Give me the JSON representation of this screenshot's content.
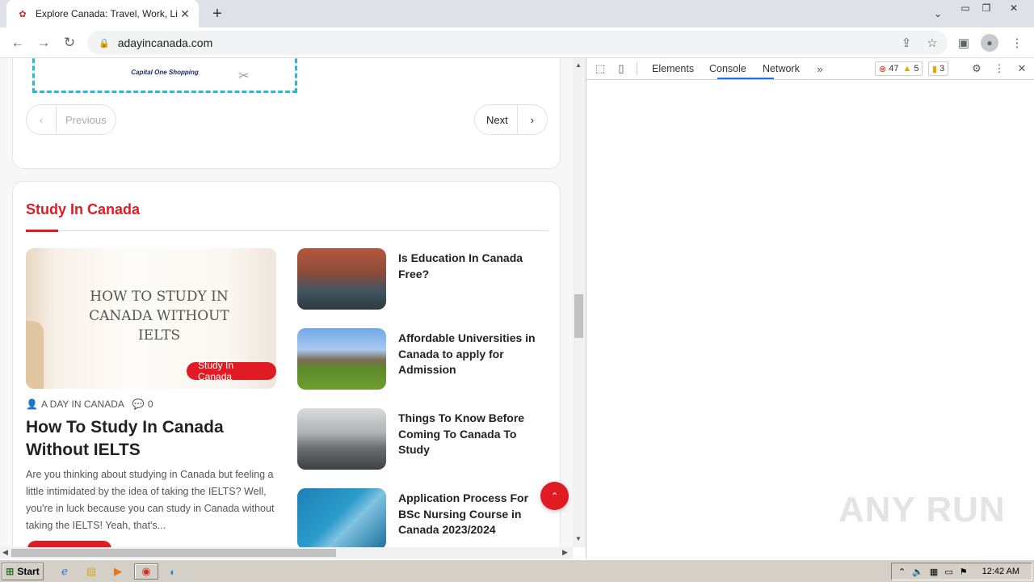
{
  "browser": {
    "tab_title": "Explore Canada: Travel, Work, Live, ...",
    "url": "adayincanada.com",
    "new_tab": "+",
    "window_controls": [
      "minimize",
      "restore",
      "close"
    ]
  },
  "page": {
    "coupon": {
      "logo_text": "Capital One Shopping"
    },
    "pagination": {
      "previous": "Previous",
      "next": "Next"
    },
    "section": {
      "title": "Study In Canada",
      "featured": {
        "image_caption": "HOW TO STUDY IN CANADA WITHOUT IELTS",
        "badge": "Study In Canada",
        "author": "A DAY IN CANADA",
        "comments": "0",
        "title": "How To Study In Canada Without IELTS",
        "excerpt": "Are you thinking about studying in Canada but feeling a little intimidated by the idea of taking the IELTS? Well, you're in luck because you can study in Canada without taking the IELTS! Yeah, that's..."
      },
      "list": [
        {
          "title": "Is Education In Canada Free?"
        },
        {
          "title": "Affordable Universities in Canada to apply for Admission"
        },
        {
          "title": "Things To Know Before Coming To Canada To Study"
        },
        {
          "title": "Application Process For BSc Nursing Course in Canada 2023/2024"
        }
      ]
    }
  },
  "devtools": {
    "tabs": [
      "Elements",
      "Console",
      "Network"
    ],
    "active_tab": "Network",
    "errors": "47",
    "warnings": "5",
    "issues": "3",
    "watermark": "ANY RUN"
  },
  "taskbar": {
    "start_label": "Start",
    "clock": "12:42 AM"
  },
  "colors": {
    "accent": "#e01b24",
    "devtools_active": "#1a73e8"
  }
}
